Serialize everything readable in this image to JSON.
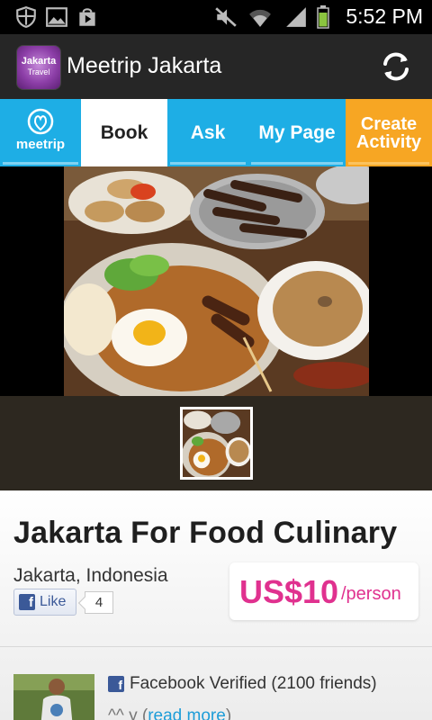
{
  "status_bar": {
    "time": "5:52 PM",
    "left_icons": [
      "shield-icon",
      "image-icon",
      "play-store-icon"
    ],
    "right_icons": [
      "mute-icon",
      "wifi-icon",
      "signal-icon",
      "battery-icon"
    ]
  },
  "action_bar": {
    "app_icon_line1": "Jakarta",
    "app_icon_line2": "Travel",
    "title": "Meetrip Jakarta",
    "refresh_icon": "refresh-icon"
  },
  "tabs": {
    "logo_label": "meetrip",
    "items": [
      {
        "label": "Book",
        "selected": true
      },
      {
        "label": "Ask",
        "selected": false
      },
      {
        "label": "My Page",
        "selected": false
      }
    ],
    "create_line1": "Create",
    "create_line2": "Activity",
    "colors": {
      "bar": "#1eaee5",
      "create": "#f7a623",
      "selected": "#ffffff"
    }
  },
  "activity": {
    "title": "Jakarta For Food Culinary",
    "location": "Jakarta, Indonesia",
    "like_label": "Like",
    "like_count": "4",
    "price": "US$10",
    "price_unit": "/person",
    "price_color": "#e0318f"
  },
  "host": {
    "verified_text": "Facebook Verified (2100 friends)",
    "snippet_prefix": "^^ y (",
    "read_more": "read more",
    "snippet_suffix": ")"
  }
}
